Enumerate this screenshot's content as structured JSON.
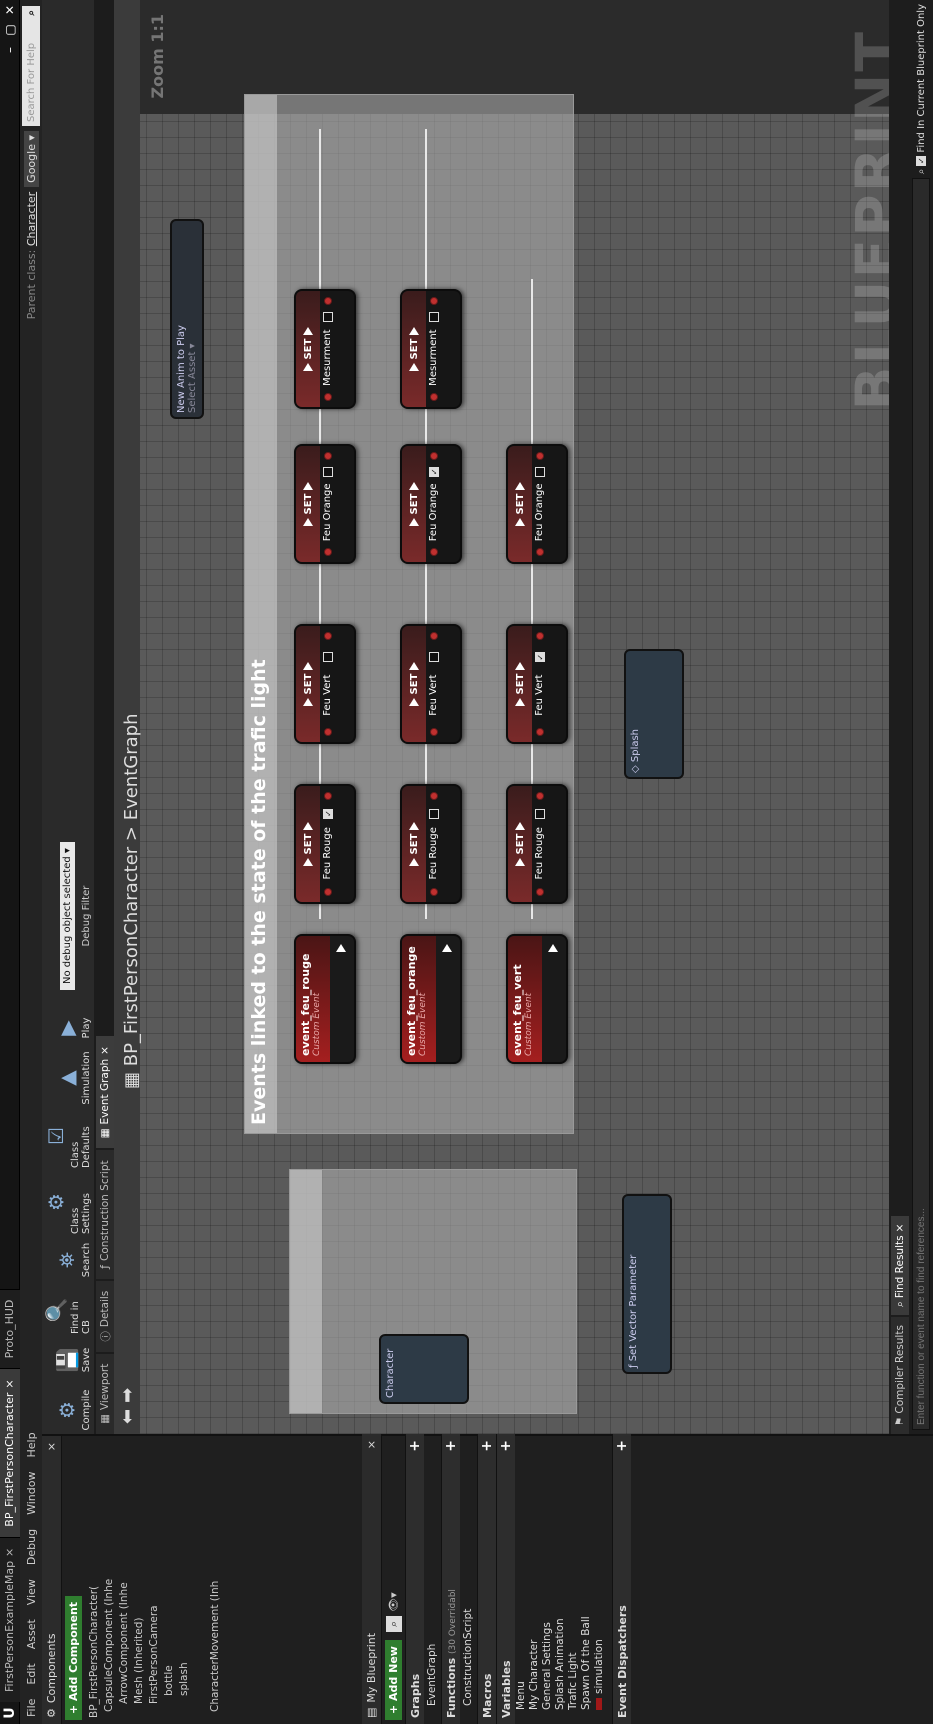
{
  "titlebar": {
    "logo": "U",
    "tabs": [
      "FirstPersonExampleMap",
      "BP_FirstPersonCharacter",
      "Proto_HUD"
    ],
    "window_buttons": [
      "–",
      "▢",
      "✕"
    ]
  },
  "menubar": {
    "items": [
      "File",
      "Edit",
      "Asset",
      "View",
      "Debug",
      "Window",
      "Help"
    ],
    "parent_class_label": "Parent class:",
    "parent_class_value": "Character",
    "google_label": "Google",
    "search_placeholder": "Search For Help"
  },
  "components": {
    "title": "Components",
    "add_label": "+ Add Component",
    "tree": [
      "BP_FirstPersonCharacter(",
      "CapsuleComponent (Inhe",
      "ArrowComponent (Inhe",
      "Mesh (Inherited)",
      "FirstPersonCamera",
      "bottle",
      "splash",
      "CharacterMovement (Inh"
    ]
  },
  "myblueprint": {
    "title": "My Blueprint",
    "add_new": "+ Add New",
    "sections": {
      "graphs": "Graphs",
      "graph_item": "EventGraph",
      "functions": "Functions",
      "functions_note": "(30 Overridabl",
      "construction": "ConstructionScript",
      "macros": "Macros",
      "variables": "Variables",
      "dispatchers": "Event Dispatchers"
    },
    "variables": [
      "Menu",
      "My Character",
      "General Settings",
      "Splash Animation",
      "Trafic Light",
      "Spawn Of the Ball",
      "simulation"
    ]
  },
  "toolbar": {
    "buttons": [
      "Compile",
      "Save",
      "Find in CB",
      "Search",
      "Class Settings",
      "Class Defaults",
      "Simulation",
      "Play"
    ],
    "debug_select": "No debug object selected",
    "debug_filter": "Debug Filter"
  },
  "editor_tabs": [
    "Viewport",
    "Details",
    "Construction Script",
    "Event Graph"
  ],
  "graph": {
    "breadcrumb": "BP_FirstPersonCharacter > EventGraph",
    "watermark": "BLUEPRINT",
    "zoom": "Zoom 1:1",
    "comment_title": "Events linked to the state of the trafic light",
    "events": [
      {
        "name": "event_feu_rouge",
        "sub": "Custom Event"
      },
      {
        "name": "event_feu_orange",
        "sub": "Custom Event"
      },
      {
        "name": "event_feu_vert",
        "sub": "Custom Event"
      }
    ],
    "set_label": "SET",
    "rows": [
      {
        "nodes": [
          {
            "var": "Feu Rouge",
            "checked": true
          },
          {
            "var": "Feu Vert",
            "checked": false
          },
          {
            "var": "Feu Orange",
            "checked": false
          },
          {
            "var": "Mesurment",
            "checked": false
          }
        ]
      },
      {
        "nodes": [
          {
            "var": "Feu Rouge",
            "checked": false
          },
          {
            "var": "Feu Vert",
            "checked": false
          },
          {
            "var": "Feu Orange",
            "checked": true
          },
          {
            "var": "Mesurment",
            "checked": false
          }
        ]
      },
      {
        "nodes": [
          {
            "var": "Feu Rouge",
            "checked": false
          },
          {
            "var": "Feu Vert",
            "checked": true
          },
          {
            "var": "Feu Orange",
            "checked": false
          }
        ]
      }
    ],
    "new_anim": "New Anim to Play",
    "select_asset": "Select Asset",
    "character_node": "Character",
    "splash_node": "Splash",
    "set_vector_node": "Set Vector Parameter"
  },
  "bottom": {
    "tabs": [
      "Compiler Results",
      "Find Results"
    ],
    "find_placeholder": "Enter function or event name to find references...",
    "find_option": "Find In Current Blueprint Only"
  }
}
